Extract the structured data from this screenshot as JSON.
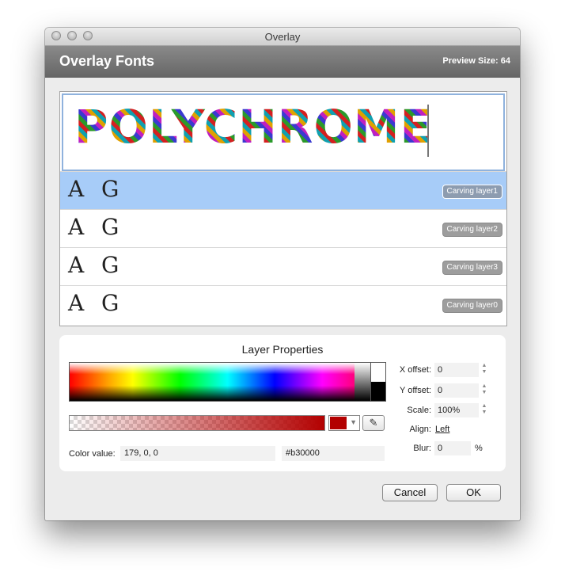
{
  "window": {
    "title": "Overlay"
  },
  "header": {
    "title": "Overlay Fonts",
    "preview_size_label": "Preview Size:",
    "preview_size_value": "64"
  },
  "preview": {
    "text": "POLYCHROME"
  },
  "layers": [
    {
      "glyphs": "A  G",
      "label": "Carving layer1",
      "selected": true
    },
    {
      "glyphs": "A  G",
      "label": "Carving layer2",
      "selected": false
    },
    {
      "glyphs": "A  G",
      "label": "Carving layer3",
      "selected": false
    },
    {
      "glyphs": "A  G",
      "label": "Carving layer0",
      "selected": false
    }
  ],
  "properties": {
    "title": "Layer Properties",
    "color_value_label": "Color value:",
    "color_rgb": "179, 0, 0",
    "color_hex": "#b30000",
    "color": "#b30000",
    "x_offset_label": "X offset:",
    "x_offset": "0",
    "y_offset_label": "Y offset:",
    "y_offset": "0",
    "scale_label": "Scale:",
    "scale": "100%",
    "align_label": "Align:",
    "align": "Left",
    "blur_label": "Blur:",
    "blur": "0",
    "blur_unit": "%"
  },
  "buttons": {
    "cancel": "Cancel",
    "ok": "OK"
  }
}
